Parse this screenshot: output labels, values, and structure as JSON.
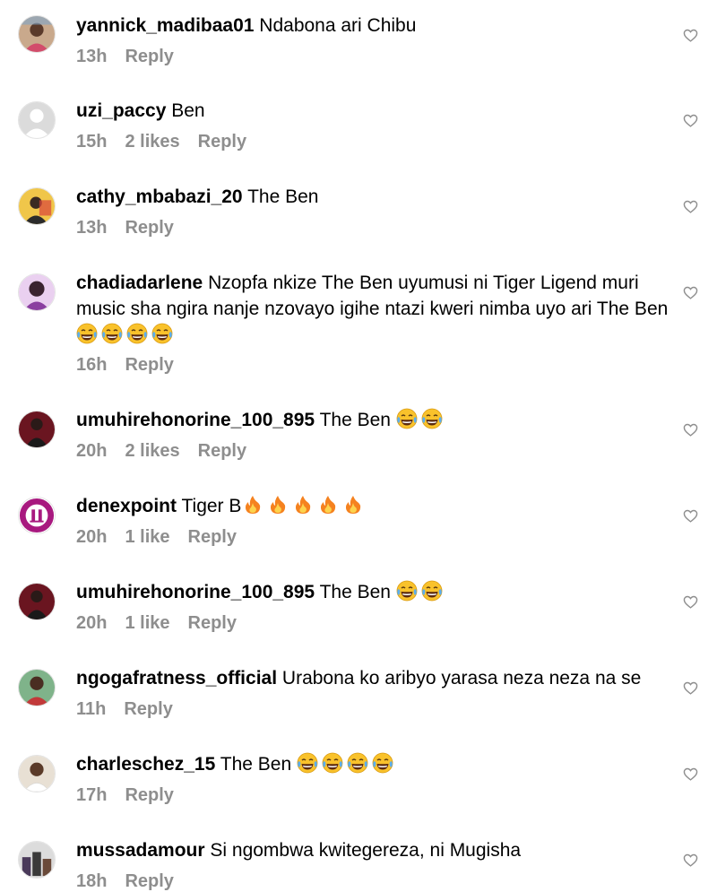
{
  "colors": {
    "meta_gray": "#8e8e8e",
    "laugh_yellow": "#f9c22b",
    "tear_blue": "#5aaef0",
    "fire_orange": "#f5821f"
  },
  "comments": [
    {
      "username": "yannick_madibaa01",
      "text": "Ndabona ari Chibu",
      "emojis": [],
      "time": "13h",
      "likes": "",
      "reply": "Reply",
      "avatar": "avatar-photo"
    },
    {
      "username": "uzi_paccy",
      "text": "Ben",
      "emojis": [],
      "time": "15h",
      "likes": "2 likes",
      "reply": "Reply",
      "avatar": "default-avatar"
    },
    {
      "username": "cathy_mbabazi_20",
      "text": "The Ben",
      "emojis": [],
      "time": "13h",
      "likes": "",
      "reply": "Reply",
      "avatar": "avatar-photo"
    },
    {
      "username": "chadiadarlene",
      "text": "Nzopfa nkize The Ben uyumusi ni Tiger Ligend muri music sha ngira nanje nzovayo igihe ntazi kweri nimba uyo ari The Ben",
      "emojis": [
        "laughing-tears-emoji",
        "laughing-tears-emoji",
        "laughing-tears-emoji",
        "laughing-tears-emoji"
      ],
      "time": "16h",
      "likes": "",
      "reply": "Reply",
      "avatar": "avatar-photo"
    },
    {
      "username": "umuhirehonorine_100_895",
      "text": "The Ben",
      "emojis": [
        "laughing-tears-emoji",
        "laughing-tears-emoji"
      ],
      "time": "20h",
      "likes": "2 likes",
      "reply": "Reply",
      "avatar": "avatar-photo"
    },
    {
      "username": "denexpoint",
      "text": "Tiger B",
      "emojis": [
        "fire-emoji",
        "fire-emoji",
        "fire-emoji",
        "fire-emoji",
        "fire-emoji"
      ],
      "time": "20h",
      "likes": "1 like",
      "reply": "Reply",
      "avatar": "brand-logo-avatar"
    },
    {
      "username": "umuhirehonorine_100_895",
      "text": "The Ben",
      "emojis": [
        "laughing-tears-emoji",
        "laughing-tears-emoji"
      ],
      "time": "20h",
      "likes": "1 like",
      "reply": "Reply",
      "avatar": "avatar-photo"
    },
    {
      "username": "ngogafratness_official",
      "text": "Urabona ko aribyo yarasa neza neza na se",
      "emojis": [],
      "time": "11h",
      "likes": "",
      "reply": "Reply",
      "avatar": "avatar-photo"
    },
    {
      "username": "charleschez_15",
      "text": "The Ben",
      "emojis": [
        "laughing-tears-emoji",
        "laughing-tears-emoji",
        "laughing-tears-emoji",
        "laughing-tears-emoji"
      ],
      "time": "17h",
      "likes": "",
      "reply": "Reply",
      "avatar": "avatar-photo"
    },
    {
      "username": "mussadamour",
      "text": "Si ngombwa kwitegereza, ni Mugisha",
      "emojis": [],
      "time": "18h",
      "likes": "",
      "reply": "Reply",
      "avatar": "avatar-photo"
    }
  ]
}
